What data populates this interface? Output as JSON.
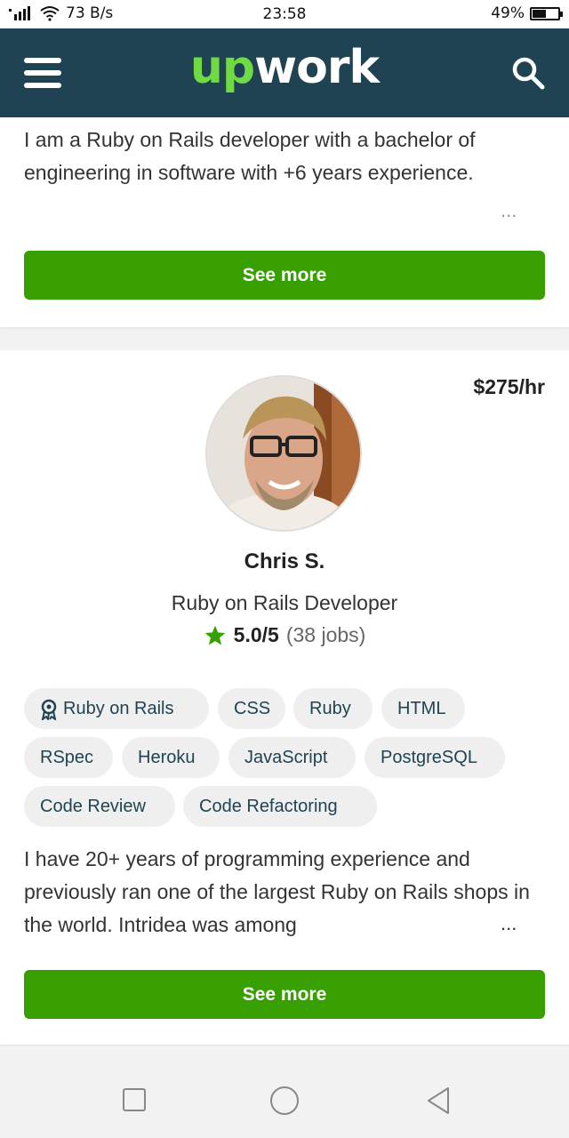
{
  "status_bar": {
    "network_speed": "73 B/s",
    "time": "23:58",
    "battery": "49%",
    "battery_level": 0.49
  },
  "header": {
    "logo_up": "up",
    "logo_work": "work"
  },
  "card1": {
    "description": "I am a Ruby on Rails developer with a bachelor of engineering in software with +6 years experience.",
    "ellipsis": "...",
    "see_more": "See more"
  },
  "card2": {
    "rate": "$275/hr",
    "name": "Chris S.",
    "title": "Ruby on Rails Developer",
    "rating_score": "5.0/5",
    "rating_jobs": "(38 jobs)",
    "skills": [
      "Ruby on Rails",
      "CSS",
      "Ruby",
      "HTML",
      "RSpec",
      "Heroku",
      "JavaScript",
      "PostgreSQL",
      "Code Review",
      "Code Refactoring"
    ],
    "description": "I have 20+ years of programming experience and previously ran one of the largest Ruby on Rails shops in the world. Intridea was among",
    "ellipsis": "...",
    "see_more": "See more"
  },
  "colors": {
    "header_bg": "#1f4352",
    "brand_green": "#37a000",
    "logo_green": "#6fda44"
  },
  "icons": [
    "signal-icon",
    "wifi-icon",
    "battery-icon",
    "hamburger-menu-icon",
    "search-icon",
    "star-icon",
    "award-badge-icon",
    "square-nav-icon",
    "circle-nav-icon",
    "back-triangle-icon"
  ]
}
